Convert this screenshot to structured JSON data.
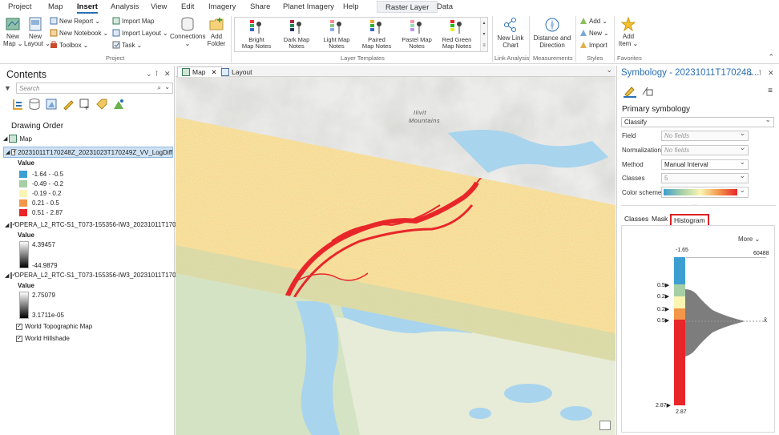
{
  "menu": {
    "tabs": [
      "Project",
      "Map",
      "Insert",
      "Analysis",
      "View",
      "Edit",
      "Imagery",
      "Share",
      "Planet Imagery",
      "Help"
    ],
    "active_tab": "Insert",
    "context_tabs": [
      "Raster Layer",
      "Data"
    ]
  },
  "ribbon": {
    "project": {
      "new_map": "New",
      "new_map_sub": "Map",
      "new_layout": "New",
      "new_layout_sub": "Layout",
      "new_report": "New Report",
      "new_notebook": "New Notebook",
      "toolbox": "Toolbox",
      "import_map": "Import Map",
      "import_layout": "Import Layout",
      "task": "Task",
      "connections": "Connections",
      "add_folder_1": "Add",
      "add_folder_2": "Folder",
      "group": "Project"
    },
    "layer_templates": {
      "items": [
        {
          "l1": "Bright",
          "l2": "Map Notes"
        },
        {
          "l1": "Dark Map",
          "l2": "Notes"
        },
        {
          "l1": "Light Map",
          "l2": "Notes"
        },
        {
          "l1": "Paired",
          "l2": "Map Notes"
        },
        {
          "l1": "Pastel Map",
          "l2": "Notes"
        },
        {
          "l1": "Red Green",
          "l2": "Map Notes"
        }
      ],
      "group": "Layer Templates"
    },
    "link_analysis": {
      "l1": "New Link",
      "l2": "Chart",
      "group": "Link Analysis"
    },
    "measurements": {
      "l1": "Distance and",
      "l2": "Direction",
      "group": "Measurements"
    },
    "styles": {
      "add": "Add",
      "new": "New",
      "import": "Import",
      "group": "Styles"
    },
    "favorites": {
      "l1": "Add",
      "l2": "Item",
      "group": "Favorites"
    }
  },
  "contents": {
    "title": "Contents",
    "search_placeholder": "Search",
    "drawing_order": "Drawing Order",
    "map_label": "Map",
    "layer1": {
      "name": "20231011T170248Z_20231023T170249Z_VV_LogDiff",
      "value_label": "Value",
      "classes": [
        {
          "label": "-1.64 - -0.5",
          "color": "#3d9fd1"
        },
        {
          "label": "-0.49 - -0.2",
          "color": "#a7cfa6"
        },
        {
          "label": "-0.19 - 0.2",
          "color": "#fbf5b3"
        },
        {
          "label": "0.21 - 0.5",
          "color": "#f2964a"
        },
        {
          "label": "0.51 - 2.87",
          "color": "#e8262a"
        }
      ]
    },
    "layer2": {
      "name": "OPERA_L2_RTC-S1_T073-155356-IW3_20231011T170...",
      "value_label": "Value",
      "max": "4.39457",
      "min": "-44.9879"
    },
    "layer3": {
      "name": "OPERA_L2_RTC-S1_T073-155356-IW3_20231011T170...",
      "value_label": "Value",
      "max": "2.75079",
      "min": "3.1711e-05"
    },
    "layer4": "World Topographic Map",
    "layer5": "World Hillshade"
  },
  "map_tabs": {
    "map": "Map",
    "layout": "Layout"
  },
  "map": {
    "place_label_1": "Ilivit",
    "place_label_2": "Mountains"
  },
  "symbology": {
    "title": "Symbology - 20231011T170248...",
    "primary": "Primary symbology",
    "renderer": "Classify",
    "field_label": "Field",
    "field_value": "No fields",
    "normalization_label": "Normalization",
    "normalization_value": "No fields",
    "method_label": "Method",
    "method_value": "Manual Interval",
    "classes_label": "Classes",
    "classes_value": "5",
    "color_scheme_label": "Color scheme",
    "subtabs": [
      "Classes",
      "Mask",
      "Histogram"
    ],
    "more": "More",
    "histogram": {
      "top_value": "-1.65",
      "top_count": "60488",
      "bottom_value": "2.87",
      "bottom_value_2": "2.87",
      "breaks": [
        "0.5",
        "0.2",
        "0.2",
        "0.5"
      ],
      "mean_symbol": "x̄"
    }
  }
}
